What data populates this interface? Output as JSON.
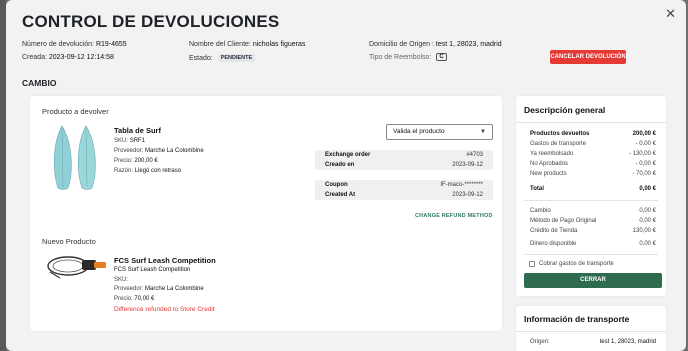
{
  "modal": {
    "title": "CONTROL DE DEVOLUCIONES",
    "close_icon": "close-icon"
  },
  "meta": {
    "return_number_label": "Número de devolución:",
    "return_number": "R19-4655",
    "created_label": "Creada:",
    "created": "2023-09-12 12:14:58",
    "client_label": "Nombre del Cliente:",
    "client": "nicholas figueras",
    "state_label": "Estado:",
    "state": "PENDIENTE",
    "origin_label": "Domicilio de Origen :",
    "origin": "test 1, 28023, madrid",
    "refund_type_label": "Tipo de Reembolso:",
    "refund_type": "C",
    "cancel_button": "CANCELAR DEVOLUCIÓN",
    "section": "CAMBIO"
  },
  "return_product": {
    "heading": "Producto a devolver",
    "name": "Tabla de Surf",
    "sku_label": "SKU:",
    "sku": "SRF1",
    "provider_label": "Proveedor:",
    "provider": "Marche La Colombine",
    "price_label": "Precio:",
    "price": "200,00 €",
    "reason_label": "Razón:",
    "reason": "Llegó con retraso",
    "validation_select": "Valida el producto",
    "chevron_icon": "chevron-down-icon"
  },
  "exchange_order": {
    "label": "Exchange order",
    "value": "#4703",
    "created_label": "Creado en",
    "created": "2023-09-12"
  },
  "coupon": {
    "label": "Coupon",
    "value": "IF-maco-********",
    "created_label": "Created At",
    "created": "2023-09-12"
  },
  "change_refund_link": "CHANGE REFUND METHOD",
  "new_product": {
    "heading": "Nuevo Producto",
    "name": "FCS Surf Leash Competition",
    "subname": "FCS Surf Leash Competition",
    "sku_label": "SKU:",
    "provider_label": "Proveedor:",
    "provider": "Marche La Colombine",
    "price_label": "Precio:",
    "price": "70,00 €",
    "note": "Difference refunded to Store Credit"
  },
  "summary": {
    "title": "Descripción general",
    "rows": [
      {
        "label": "Productos devueltos",
        "value": "200,00 €"
      },
      {
        "label": "Gastos de transporte",
        "value": "- 0,00 €"
      },
      {
        "label": "Ya reembolsado",
        "value": "- 130,00 €"
      },
      {
        "label": "No Aprobados",
        "value": "- 0,00 €"
      },
      {
        "label": "New products",
        "value": "- 70,00 €"
      }
    ],
    "total_label": "Total",
    "total_value": "0,00 €",
    "methods": [
      {
        "label": "Cambio",
        "value": "0,00 €"
      },
      {
        "label": "Método de Pago Original",
        "value": "0,00 €"
      },
      {
        "label": "Crédito de Tienda",
        "value": "130,00 €"
      }
    ],
    "available_label": "Dinero disponible",
    "available_value": "0,00 €",
    "shipping_checkbox": "Cobrar gastos de transporte",
    "close_button": "CERRAR"
  },
  "transport": {
    "title": "Información de transporte",
    "origin_label": "Origen:",
    "origin": "test 1, 28023, madrid"
  },
  "colors": {
    "danger": "#e53935",
    "primary": "#2f6b4e",
    "link": "#2e7d5b"
  }
}
